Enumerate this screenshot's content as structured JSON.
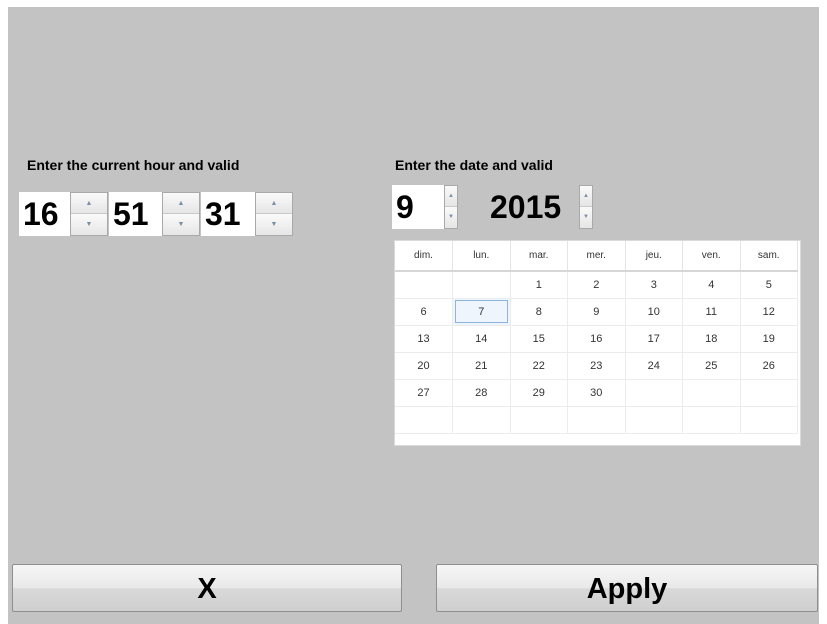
{
  "time_section": {
    "label": "Enter the current hour and valid",
    "hour": "16",
    "minute": "51",
    "second": "31"
  },
  "date_section": {
    "label": "Enter the date and valid",
    "month": "9",
    "year": "2015"
  },
  "calendar": {
    "weekdays": [
      "dim.",
      "lun.",
      "mar.",
      "mer.",
      "jeu.",
      "ven.",
      "sam."
    ],
    "weeks": [
      [
        "",
        "",
        "1",
        "2",
        "3",
        "4",
        "5"
      ],
      [
        "6",
        "7",
        "8",
        "9",
        "10",
        "11",
        "12"
      ],
      [
        "13",
        "14",
        "15",
        "16",
        "17",
        "18",
        "19"
      ],
      [
        "20",
        "21",
        "22",
        "23",
        "24",
        "25",
        "26"
      ],
      [
        "27",
        "28",
        "29",
        "30",
        "",
        "",
        ""
      ],
      [
        "",
        "",
        "",
        "",
        "",
        "",
        ""
      ]
    ],
    "selected_day": "7"
  },
  "icons": {
    "spin_up": "triangle-up-icon",
    "spin_down": "triangle-down-icon"
  },
  "buttons": {
    "cancel_label": "X",
    "apply_label": "Apply"
  }
}
